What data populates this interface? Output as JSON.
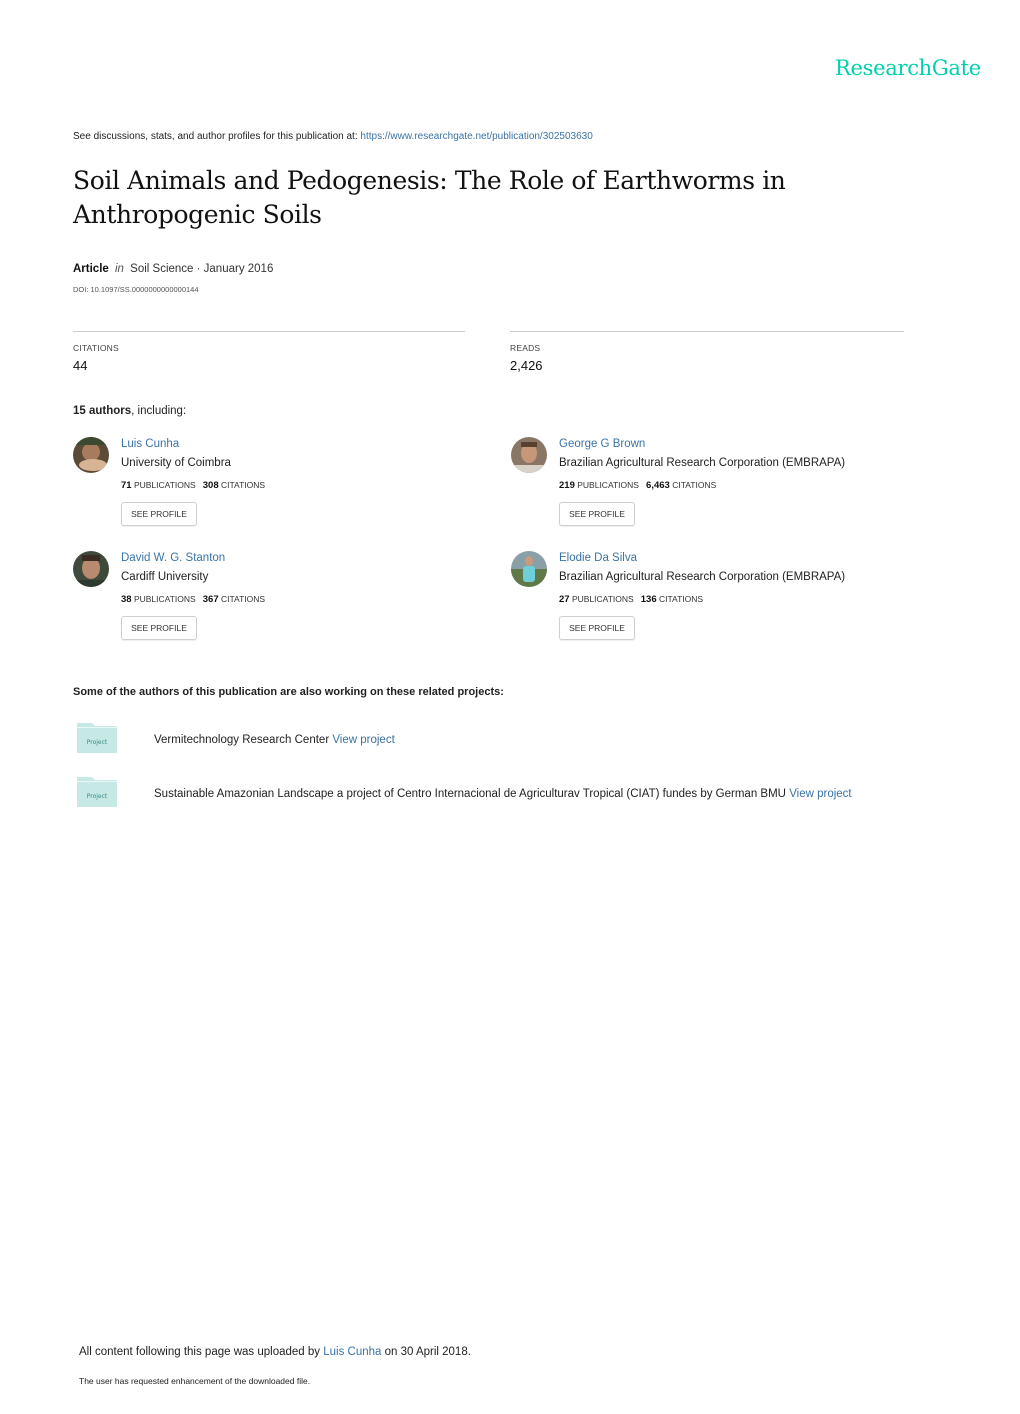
{
  "brand": {
    "logo_text": "ResearchGate",
    "color": "#00d0af"
  },
  "header": {
    "see_text": "See discussions, stats, and author profiles for this publication at: ",
    "url": "https://www.researchgate.net/publication/302503630"
  },
  "publication": {
    "title": "Soil Animals and Pedogenesis: The Role of Earthworms in Anthropogenic Soils",
    "type": "Article",
    "in_word": "in",
    "journal_date": "Soil Science · January 2016",
    "doi": "DOI: 10.1097/SS.0000000000000144"
  },
  "stats": {
    "citations_label": "CITATIONS",
    "citations_value": "44",
    "reads_label": "READS",
    "reads_value": "2,426"
  },
  "authors_heading": {
    "count": "15 authors",
    "suffix": ", including:"
  },
  "authors": [
    {
      "name": "Luis Cunha",
      "institution": "University of Coimbra",
      "publications": "71",
      "citations": "308",
      "button": "SEE PROFILE"
    },
    {
      "name": "George G Brown",
      "institution": "Brazilian Agricultural Research Corporation (EMBRAPA)",
      "publications": "219",
      "citations": "6,463",
      "button": "SEE PROFILE"
    },
    {
      "name": "David W. G. Stanton",
      "institution": "Cardiff University",
      "publications": "38",
      "citations": "367",
      "button": "SEE PROFILE"
    },
    {
      "name": "Elodie Da Silva",
      "institution": "Brazilian Agricultural Research Corporation (EMBRAPA)",
      "publications": "27",
      "citations": "136",
      "button": "SEE PROFILE"
    }
  ],
  "labels": {
    "publications": "PUBLICATIONS",
    "citations": "CITATIONS"
  },
  "related": {
    "heading": "Some of the authors of this publication are also working on these related projects:",
    "icon_label": "Project",
    "projects": [
      {
        "text": "Vermitechnology Research Center ",
        "link": "View project"
      },
      {
        "text": "Sustainable Amazonian Landscape a project of Centro Internacional de Agriculturav Tropical (CIAT) fundes by German BMU ",
        "link": "View project"
      }
    ]
  },
  "footer": {
    "upload_prefix": "All content following this page was uploaded by ",
    "uploader": "Luis Cunha",
    "upload_suffix": " on 30 April 2018.",
    "note": "The user has requested enhancement of the downloaded file."
  }
}
